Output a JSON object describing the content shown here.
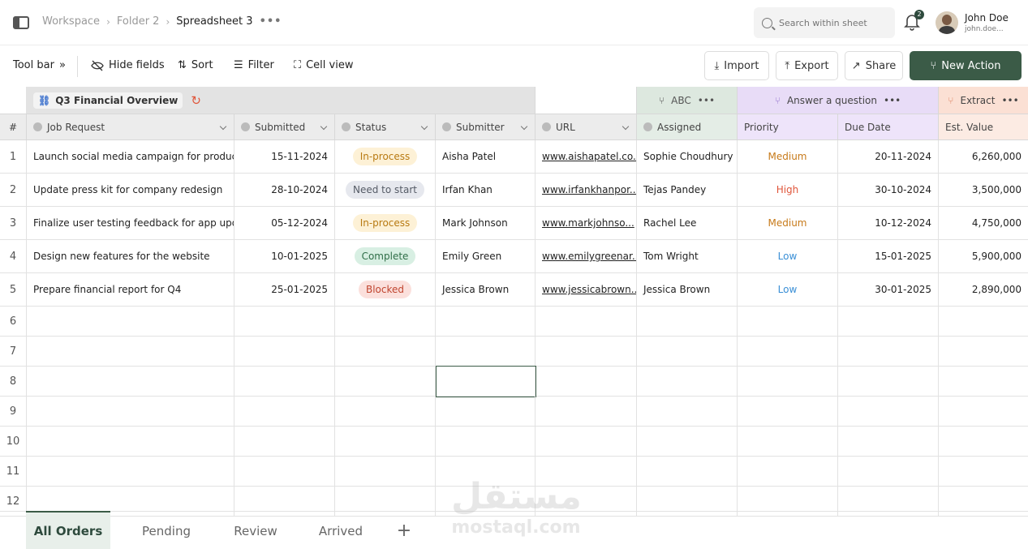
{
  "breadcrumb": {
    "items": [
      "Workspace",
      "Folder 2",
      "Spreadsheet 3"
    ],
    "more": "•••"
  },
  "search": {
    "placeholder": "Search within sheet"
  },
  "notifications": {
    "count": "2"
  },
  "user": {
    "name": "John Doe",
    "email": "john.doe..."
  },
  "toolbar": {
    "toolbar_label": "Tool bar",
    "hide_fields": "Hide fields",
    "sort": "Sort",
    "filter": "Filter",
    "cell_view": "Cell view",
    "import": "Import",
    "export": "Export",
    "share": "Share",
    "new_action": "New Action"
  },
  "bands": {
    "group": "Q3 Financial Overview",
    "abc": "ABC",
    "answer": "Answer a question",
    "extract": "Extract",
    "more": "•••"
  },
  "columns": [
    "#",
    "Job Request",
    "Submitted",
    "Status",
    "Submitter",
    "URL",
    "Assigned",
    "Priority",
    "Due Date",
    "Est. Value"
  ],
  "rows": [
    {
      "num": "1",
      "job": "Launch social media campaign for product ...",
      "submitted": "15-11-2024",
      "status": "In-process",
      "submitter": "Aisha Patel",
      "url": "www.aishapatel.co...",
      "assigned": "Sophie Choudhury",
      "priority": "Medium",
      "due": "20-11-2024",
      "value": "6,260,000"
    },
    {
      "num": "2",
      "job": "Update press kit for company redesign",
      "submitted": "28-10-2024",
      "status": "Need to start",
      "submitter": "Irfan Khan",
      "url": "www.irfankhanpor...",
      "assigned": "Tejas Pandey",
      "priority": "High",
      "due": "30-10-2024",
      "value": "3,500,000"
    },
    {
      "num": "3",
      "job": "Finalize user testing feedback for app update",
      "submitted": "05-12-2024",
      "status": "In-process",
      "submitter": "Mark Johnson",
      "url": "www.markjohnso...",
      "assigned": "Rachel Lee",
      "priority": "Medium",
      "due": "10-12-2024",
      "value": "4,750,000"
    },
    {
      "num": "4",
      "job": "Design new features for the website",
      "submitted": "10-01-2025",
      "status": "Complete",
      "submitter": "Emily Green",
      "url": "www.emilygreenar...",
      "assigned": "Tom Wright",
      "priority": "Low",
      "due": "15-01-2025",
      "value": "5,900,000"
    },
    {
      "num": "5",
      "job": "Prepare financial report for Q4",
      "submitted": "25-01-2025",
      "status": "Blocked",
      "submitter": "Jessica Brown",
      "url": "www.jessicabrown...",
      "assigned": "Jessica Brown",
      "priority": "Low",
      "due": "30-01-2025",
      "value": "2,890,000"
    }
  ],
  "empty_rows": [
    "6",
    "7",
    "8",
    "9",
    "10",
    "11",
    "12"
  ],
  "tabs": [
    "All Orders",
    "Pending",
    "Review",
    "Arrived"
  ],
  "add_tab": "+",
  "watermark": {
    "arabic": "مستقل",
    "latin": "mostaql.com"
  },
  "colors": {
    "accent": "#3b5b47",
    "in_process_bg": "#fdf1d6",
    "in_process_fg": "#b87a12",
    "need_start_bg": "#e6e8ee",
    "need_start_fg": "#555b66",
    "complete_bg": "#d8efe3",
    "complete_fg": "#2f6e48",
    "blocked_bg": "#fbe0dc",
    "blocked_fg": "#c0452f",
    "priority_medium": "#c77a1a",
    "priority_high": "#e0553a",
    "priority_low": "#3a8fd6",
    "band_abc": "#dde8df",
    "band_answer": "#e8dcf7",
    "band_extract": "#fbe0d4"
  }
}
